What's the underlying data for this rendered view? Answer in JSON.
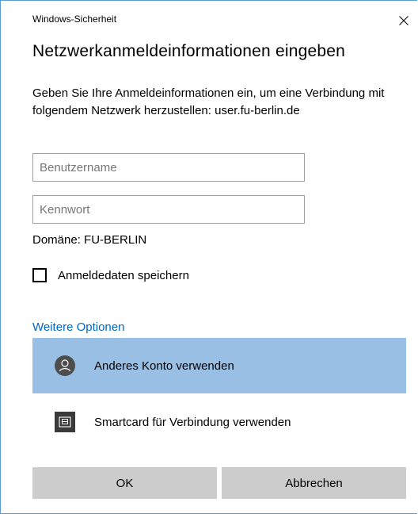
{
  "window": {
    "title": "Windows-Sicherheit",
    "close_icon": "close-icon"
  },
  "dialog": {
    "heading": "Netzwerkanmeldeinformationen eingeben",
    "description": "Geben Sie Ihre Anmeldeinformationen ein, um eine Verbindung mit folgendem Netzwerk herzustellen: user.fu-berlin.de",
    "username": {
      "value": "",
      "placeholder": "Benutzername"
    },
    "password": {
      "value": "",
      "placeholder": "Kennwort"
    },
    "domain_label": "Domäne: FU-BERLIN",
    "remember": {
      "label": "Anmeldedaten speichern",
      "checked": false
    },
    "more_options_label": "Weitere Optionen",
    "options": [
      {
        "label": "Anderes Konto verwenden",
        "icon": "user-avatar-icon",
        "selected": true
      },
      {
        "label": "Smartcard für Verbindung verwenden",
        "icon": "smartcard-icon",
        "selected": false
      }
    ],
    "ok_label": "OK",
    "cancel_label": "Abbrechen"
  },
  "colors": {
    "accent": "#0067c0",
    "selected_bg": "#99c0e4",
    "button_bg": "#cccccc",
    "border": "#5b9bd5"
  }
}
